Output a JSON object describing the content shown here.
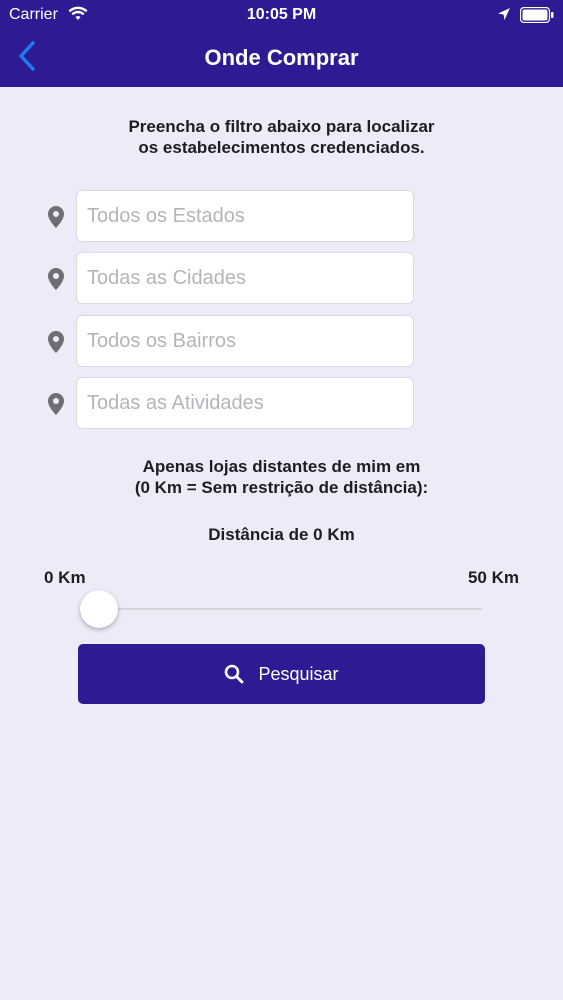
{
  "status_bar": {
    "carrier": "Carrier",
    "time": "10:05 PM"
  },
  "nav": {
    "title": "Onde Comprar",
    "back_icon": "chevron-left-icon"
  },
  "intro": {
    "line1": "Preencha o filtro abaixo para localizar",
    "line2": "os estabelecimentos credenciados."
  },
  "filters": [
    {
      "placeholder": "Todos os Estados",
      "value": "",
      "icon": "map-pin-icon"
    },
    {
      "placeholder": "Todas as Cidades",
      "value": "",
      "icon": "map-pin-icon"
    },
    {
      "placeholder": "Todos os Bairros",
      "value": "",
      "icon": "map-pin-icon"
    },
    {
      "placeholder": "Todas as Atividades",
      "value": "",
      "icon": "map-pin-icon"
    }
  ],
  "distance": {
    "line1": "Apenas lojas distantes de mim em",
    "line2": "(0 Km = Sem restrição de distância):",
    "current_label": "Distância de 0 Km",
    "min_label": "0 Km",
    "max_label": "50 Km",
    "value": 0
  },
  "search_button": {
    "label": "Pesquisar",
    "icon": "search-icon"
  },
  "colors": {
    "brand": "#2e1b94",
    "background": "#ecebf8",
    "back_icon": "#1e7cf5"
  }
}
